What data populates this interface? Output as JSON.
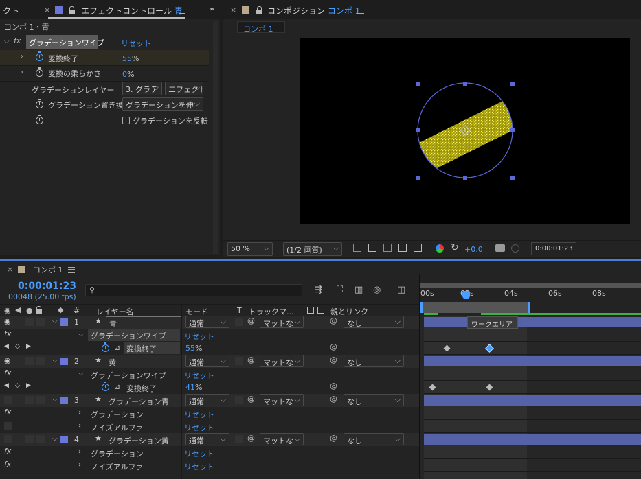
{
  "effect_controls": {
    "tab_partial": "クト",
    "tab_title": "エフェクトコントロール",
    "tab_layer": "青",
    "breadcrumb": "コンポ 1・青",
    "effect_name": "グラデーションワイプ",
    "reset_label": "リセット",
    "props": [
      {
        "label": "変換終了",
        "value": "55",
        "unit": "%"
      },
      {
        "label": "変換の柔らかさ",
        "value": "0",
        "unit": "%"
      }
    ],
    "gradient_layer_label": "グラデーションレイヤー",
    "gradient_layer_value": "3. グラデ",
    "gradient_layer_source": "エフェクト",
    "placement_label": "グラデーション置き換",
    "placement_value": "グラデーションを伸",
    "invert_label": "グラデーションを反転",
    "fx_label": "fx"
  },
  "composition": {
    "tab_label": "コンポジション",
    "comp_name": "コンポ 1",
    "viewer_tab": "コンポ 1",
    "zoom": "50 %",
    "resolution": "(1/2 画質)",
    "exposure": "+0.0",
    "timecode": "0:00:01:23"
  },
  "timeline": {
    "tab_label": "コンポ 1",
    "current_time": "0:00:01:23",
    "frames": "00048 (25.00 fps)",
    "search_placeholder": "",
    "col_number": "#",
    "col_layer_name": "レイヤー名",
    "col_mode": "モード",
    "col_t": "T",
    "col_track_matte": "トラックマ...",
    "col_parent": "親とリンク",
    "ruler_labels": [
      "00s",
      "02s",
      "04s",
      "06s",
      "08s"
    ],
    "work_area_tooltip": "ワークエリア",
    "layers": [
      {
        "num": "1",
        "name": "青",
        "mode": "通常",
        "matte": "マットな",
        "parent": "なし",
        "effect": "グラデーションワイプ",
        "reset": "リセット",
        "prop": "変換終了",
        "prop_value": "55",
        "unit": "%"
      },
      {
        "num": "2",
        "name": "黄",
        "mode": "通常",
        "matte": "マットな",
        "parent": "なし",
        "effect": "グラデーションワイプ",
        "reset": "リセット",
        "prop": "変換終了",
        "prop_value": "41",
        "unit": "%"
      },
      {
        "num": "3",
        "name": "グラデーション青",
        "mode": "通常",
        "matte": "マットな",
        "parent": "なし",
        "effect1": "グラデーション",
        "effect2": "ノイズアルファ",
        "reset": "リセット"
      },
      {
        "num": "4",
        "name": "グラデーション黄",
        "mode": "通常",
        "matte": "マットな",
        "parent": "なし",
        "effect1": "グラデーション",
        "effect2": "ノイズアルファ",
        "reset": "リセット"
      }
    ]
  },
  "colors": {
    "accent": "#4a9eff",
    "label_blue": "#6b76d8",
    "track_bar": "#5662a8",
    "layer_cyan": "#00ffff",
    "layer_yellow": "#e5d800",
    "comp_swatch": "#b9a98f"
  },
  "icons": [
    "close-icon",
    "lock-icon",
    "menu-icon",
    "stopwatch-icon",
    "eye-icon",
    "audio-icon",
    "solo-icon",
    "label-icon",
    "star-icon",
    "graph-icon",
    "spiral-icon",
    "camera-icon",
    "color-icon",
    "search-icon"
  ]
}
